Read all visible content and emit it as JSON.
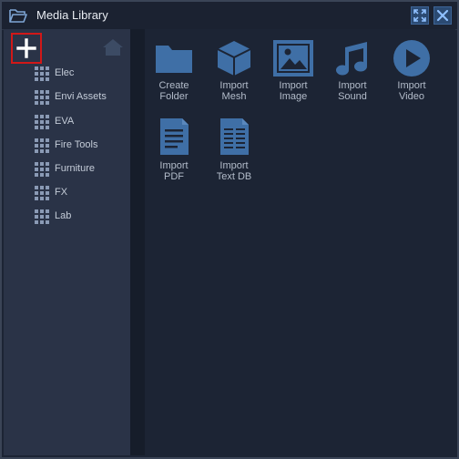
{
  "window": {
    "title": "Media Library",
    "accent": "#3f6fa6"
  },
  "sidebar": {
    "items": [
      {
        "label": "Elec"
      },
      {
        "label": "Envi Assets"
      },
      {
        "label": "EVA"
      },
      {
        "label": "Fire Tools"
      },
      {
        "label": "Furniture"
      },
      {
        "label": "FX"
      },
      {
        "label": "Lab"
      }
    ]
  },
  "actions": [
    {
      "line1": "Create",
      "line2": "Folder",
      "icon": "folder-icon"
    },
    {
      "line1": "Import",
      "line2": "Mesh",
      "icon": "mesh-cube-icon"
    },
    {
      "line1": "Import",
      "line2": "Image",
      "icon": "image-icon"
    },
    {
      "line1": "Import",
      "line2": "Sound",
      "icon": "music-note-icon"
    },
    {
      "line1": "Import",
      "line2": "Video",
      "icon": "play-icon"
    },
    {
      "line1": "Import",
      "line2": "PDF",
      "icon": "document-icon"
    },
    {
      "line1": "Import",
      "line2": "Text DB",
      "icon": "text-db-icon"
    }
  ]
}
